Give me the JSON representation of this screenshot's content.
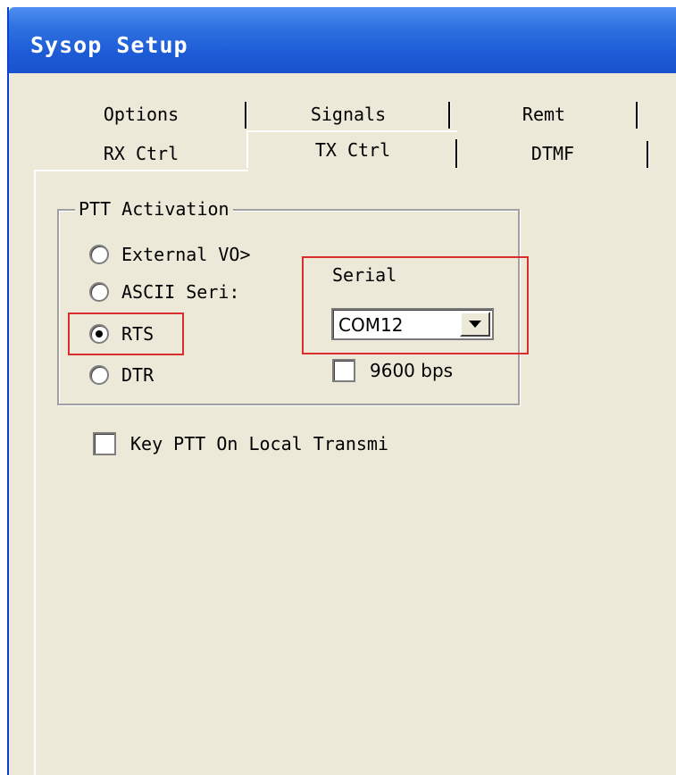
{
  "window": {
    "title": "Sysop Setup"
  },
  "tabs": {
    "row_back": [
      "Options",
      "Signals",
      "Remt"
    ],
    "row_front": [
      "RX Ctrl",
      "TX Ctrl",
      "DTMF"
    ],
    "active": "TX Ctrl"
  },
  "ptt_activation": {
    "title": "PTT Activation",
    "options": [
      {
        "label": "External VO>",
        "checked": false
      },
      {
        "label": "ASCII Seri:",
        "checked": false
      },
      {
        "label": "RTS",
        "checked": true
      },
      {
        "label": "DTR",
        "checked": false
      }
    ],
    "serial": {
      "label": "Serial",
      "port_value": "COM12",
      "bps_label": "9600 bps",
      "bps_checked": false
    }
  },
  "key_ptt_local": {
    "label": "Key PTT On Local Transmi",
    "checked": false
  },
  "colors": {
    "highlight": "#d92e2e",
    "title_bar": "#1d5bd6",
    "dialog_bg": "#ece9d8"
  },
  "icons": {
    "combo_dropdown": "chevron-down-icon"
  }
}
